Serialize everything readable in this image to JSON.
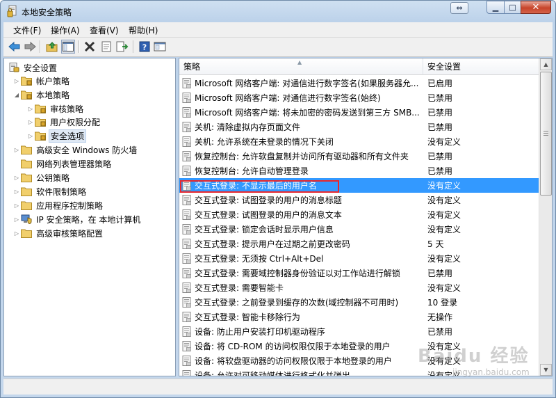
{
  "window": {
    "title": "本地安全策略",
    "close_glyph": "✕",
    "minimize_glyph": "▁",
    "maximize_glyph": "□",
    "swap_glyph": "⇔"
  },
  "menu": {
    "items": [
      "文件(F)",
      "操作(A)",
      "查看(V)",
      "帮助(H)"
    ]
  },
  "toolbar": {
    "buttons": [
      "back-icon",
      "forward-icon",
      "up-folder-icon",
      "show-tree-icon",
      "delete-icon",
      "properties-icon",
      "export-list-icon",
      "help-icon",
      "console-icon"
    ]
  },
  "tree": {
    "root": "安全设置",
    "items": [
      "帐户策略",
      "本地策略",
      "审核策略",
      "用户权限分配",
      "安全选项",
      "高级安全 Windows 防火墙",
      "网络列表管理器策略",
      "公钥策略",
      "软件限制策略",
      "应用程序控制策略",
      "IP 安全策略，在 本地计算机",
      "高级审核策略配置"
    ]
  },
  "list": {
    "header_policy": "策略",
    "header_setting": "安全设置",
    "rows": [
      {
        "policy": "Microsoft 网络客户端: 对通信进行数字签名(如果服务器允...",
        "setting": "已启用"
      },
      {
        "policy": "Microsoft 网络客户端: 对通信进行数字签名(始终)",
        "setting": "已禁用"
      },
      {
        "policy": "Microsoft 网络客户端: 将未加密的密码发送到第三方 SMB...",
        "setting": "已禁用"
      },
      {
        "policy": "关机: 清除虚拟内存页面文件",
        "setting": "已禁用"
      },
      {
        "policy": "关机: 允许系统在未登录的情况下关闭",
        "setting": "没有定义"
      },
      {
        "policy": "恢复控制台: 允许软盘复制并访问所有驱动器和所有文件夹",
        "setting": "已禁用"
      },
      {
        "policy": "恢复控制台: 允许自动管理登录",
        "setting": "已禁用"
      },
      {
        "policy": "交互式登录: 不显示最后的用户名",
        "setting": "没有定义"
      },
      {
        "policy": "交互式登录: 试图登录的用户的消息标题",
        "setting": "没有定义"
      },
      {
        "policy": "交互式登录: 试图登录的用户的消息文本",
        "setting": "没有定义"
      },
      {
        "policy": "交互式登录: 锁定会话时显示用户信息",
        "setting": "没有定义"
      },
      {
        "policy": "交互式登录: 提示用户在过期之前更改密码",
        "setting": "5 天"
      },
      {
        "policy": "交互式登录: 无须按 Ctrl+Alt+Del",
        "setting": "没有定义"
      },
      {
        "policy": "交互式登录: 需要域控制器身份验证以对工作站进行解锁",
        "setting": "已禁用"
      },
      {
        "policy": "交互式登录: 需要智能卡",
        "setting": "没有定义"
      },
      {
        "policy": "交互式登录: 之前登录到缓存的次数(域控制器不可用时)",
        "setting": "10 登录"
      },
      {
        "policy": "交互式登录: 智能卡移除行为",
        "setting": "无操作"
      },
      {
        "policy": "设备: 防止用户安装打印机驱动程序",
        "setting": "已禁用"
      },
      {
        "policy": "设备: 将 CD-ROM 的访问权限仅限于本地登录的用户",
        "setting": "没有定义"
      },
      {
        "policy": "设备: 将软盘驱动器的访问权限仅限于本地登录的用户",
        "setting": "没有定义"
      },
      {
        "policy": "设备: 允许对可移动媒体进行格式化并弹出",
        "setting": "没有定义"
      }
    ],
    "selected_index": 7
  },
  "watermark": {
    "text": "Baidu 经验",
    "url": "jingyan.baidu.com"
  },
  "colors": {
    "selection": "#3399ff",
    "highlight_border": "#e8282d"
  }
}
